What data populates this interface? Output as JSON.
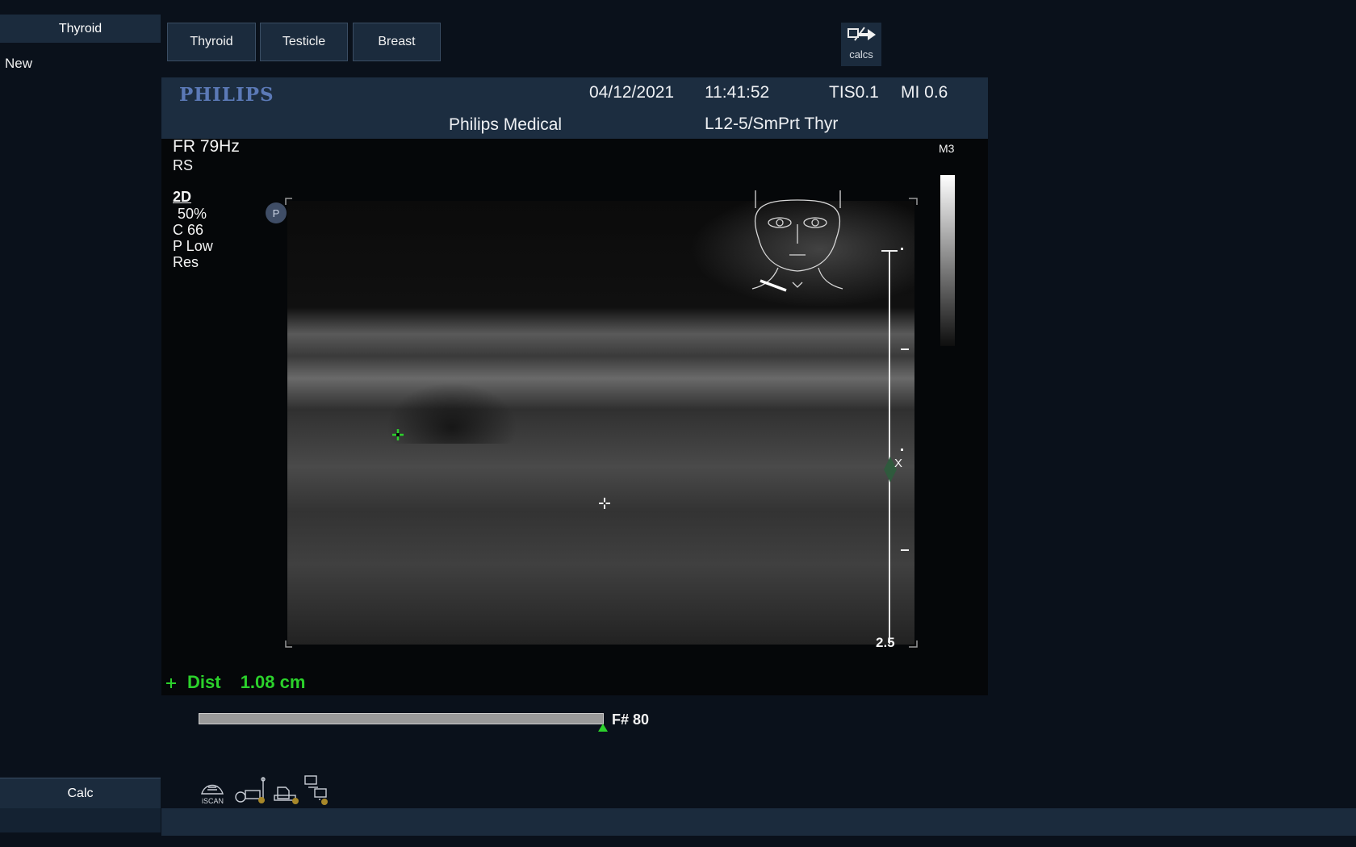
{
  "left_panel": {
    "header": "Thyroid",
    "item": "New",
    "calc_button": "Calc"
  },
  "tabs": [
    "Thyroid",
    "Testicle",
    "Breast"
  ],
  "calcs_button": {
    "label": "calcs",
    "icon": "calcs-arrow-icon"
  },
  "header": {
    "logo": "PHILIPS",
    "date": "04/12/2021",
    "time": "11:41:52",
    "tis": "TIS0.1",
    "mi": "MI 0.6",
    "institution": "Philips Medical",
    "transducer": "L12-5/SmPrt Thyr"
  },
  "overlay": {
    "frame_rate": "FR 79Hz",
    "rs": "RS",
    "mode": "2D",
    "gain": "50%",
    "compression": "C 66",
    "persistence": "P Low",
    "resolution": "Res",
    "map": "M3",
    "depth": "2.5",
    "focus_marker": "X",
    "p_marker": "P"
  },
  "measurement": {
    "label": "Dist",
    "value": "1.08 cm"
  },
  "frame": {
    "label": "F# 80",
    "position_fraction": 1.0
  },
  "colors": {
    "measure_green": "#2bd12b",
    "panel": "#1b2b3d",
    "logo": "#5b79b6"
  },
  "status_icons": [
    "iscan-icon",
    "transducer-icon",
    "printer-icon",
    "network-icon"
  ],
  "status_icon_label": "iSCAN"
}
